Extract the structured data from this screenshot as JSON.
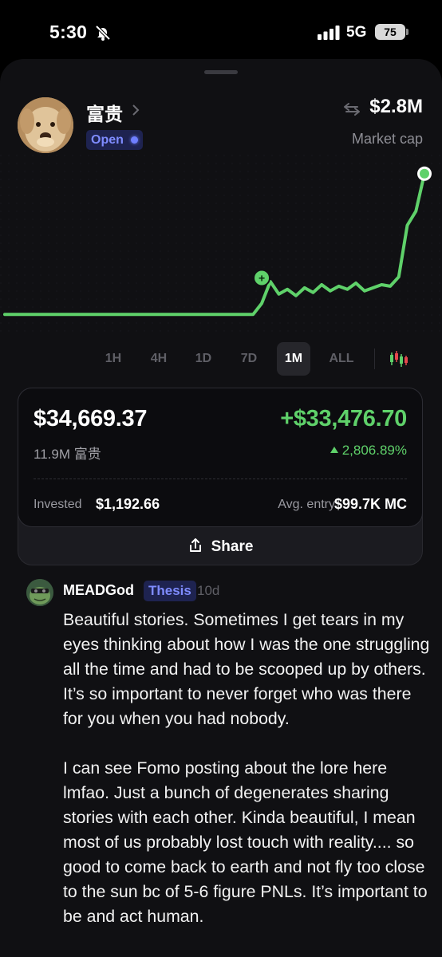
{
  "status_bar": {
    "time": "5:30",
    "network": "5G",
    "battery": "75"
  },
  "token": {
    "name": "富贵",
    "status_badge": "Open",
    "market_cap": "$2.8M",
    "market_cap_label": "Market cap"
  },
  "chart_data": {
    "type": "line",
    "x": [
      "t0",
      "t1",
      "t2",
      "t3",
      "t4",
      "t5",
      "t6",
      "t7",
      "t8",
      "t9",
      "t10",
      "t11",
      "t12",
      "t13",
      "t14",
      "t15",
      "t16",
      "t17",
      "t18",
      "t19",
      "t20",
      "t21",
      "t22",
      "t23",
      "t24",
      "t25",
      "t26",
      "t27",
      "t28",
      "t29",
      "t30",
      "t31",
      "t32",
      "t33",
      "t34",
      "t35",
      "t36",
      "t37",
      "t38",
      "t39",
      "t40",
      "t41",
      "t42",
      "t43",
      "t44",
      "t45",
      "t46",
      "t47",
      "t48",
      "t49"
    ],
    "series": [
      {
        "values": [
          0.05,
          0.05,
          0.05,
          0.05,
          0.05,
          0.05,
          0.05,
          0.05,
          0.05,
          0.05,
          0.05,
          0.05,
          0.05,
          0.05,
          0.05,
          0.05,
          0.05,
          0.05,
          0.05,
          0.05,
          0.05,
          0.05,
          0.05,
          0.05,
          0.05,
          0.05,
          0.05,
          0.05,
          0.05,
          0.05,
          0.12,
          0.26,
          0.18,
          0.21,
          0.17,
          0.22,
          0.19,
          0.24,
          0.2,
          0.23,
          0.21,
          0.25,
          0.2,
          0.22,
          0.24,
          0.23,
          0.29,
          0.62,
          0.71,
          0.95
        ]
      }
    ],
    "markers": [
      {
        "x": "t30",
        "label": "+"
      }
    ],
    "color": "#5fd16a"
  },
  "timeframes": [
    {
      "label": "1H",
      "active": false
    },
    {
      "label": "4H",
      "active": false
    },
    {
      "label": "1D",
      "active": false
    },
    {
      "label": "7D",
      "active": false
    },
    {
      "label": "1M",
      "active": true
    },
    {
      "label": "ALL",
      "active": false
    }
  ],
  "position": {
    "value": "$34,669.37",
    "pnl": "+$33,476.70",
    "holdings": "11.9M 富贵",
    "pnl_percent": "2,806.89%",
    "invested_label": "Invested",
    "invested_value": "$1,192.66",
    "avg_entry_label": "Avg. entry",
    "avg_entry_value": "$99.7K MC",
    "share_label": "Share"
  },
  "comment": {
    "author": "MEADGod",
    "tag": "Thesis",
    "age": "10d",
    "paragraphs": [
      "Beautiful stories. Sometimes I get tears in my eyes thinking about how I was the one struggling all the time and had to be scooped up by others. It’s so important to never forget who was there for you when you had nobody.",
      "I can see Fomo posting about the lore here lmfao. Just a bunch of degenerates sharing stories with each other. Kinda beautiful, I mean most of us probably lost touch with reality.... so good to come back to earth and not fly too close to the sun bc of 5-6 figure PNLs. It’s important to be and act human."
    ]
  },
  "colors": {
    "accent_green": "#5fd16a",
    "badge_blue": "#7f8cff",
    "background": "#101013"
  }
}
